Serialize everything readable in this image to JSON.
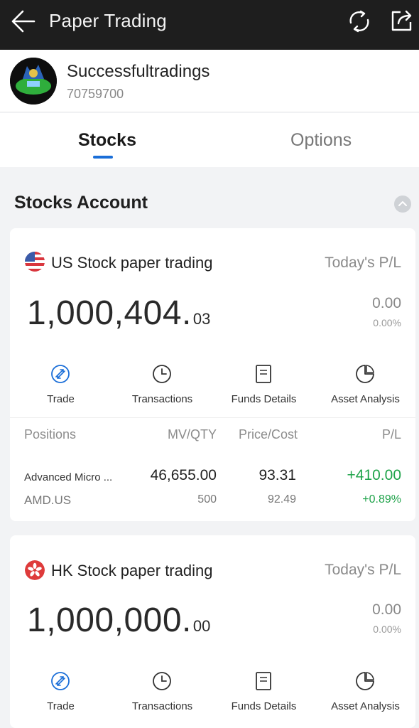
{
  "header": {
    "title": "Paper Trading",
    "back_icon": "arrow-left-icon",
    "refresh_icon": "refresh-icon",
    "share_icon": "share-icon"
  },
  "profile": {
    "name": "Successfultradings",
    "id": "70759700"
  },
  "tabs": [
    {
      "label": "Stocks",
      "active": true
    },
    {
      "label": "Options",
      "active": false
    }
  ],
  "section": {
    "title": "Stocks Account"
  },
  "accounts": [
    {
      "name": "US Stock paper trading",
      "pl_label": "Today's P/L",
      "balance_main": "1,000,404.",
      "balance_cents": "03",
      "pl_value": "0.00",
      "pl_percent": "0.00%",
      "flag_icon": "us-flag-icon"
    },
    {
      "name": "HK Stock paper trading",
      "pl_label": "Today's P/L",
      "balance_main": "1,000,000.",
      "balance_cents": "00",
      "pl_value": "0.00",
      "pl_percent": "0.00%",
      "flag_icon": "hk-flag-icon"
    }
  ],
  "actions": [
    {
      "label": "Trade",
      "icon": "trade-icon"
    },
    {
      "label": "Transactions",
      "icon": "clock-icon"
    },
    {
      "label": "Funds Details",
      "icon": "document-icon"
    },
    {
      "label": "Asset Analysis",
      "icon": "pie-chart-icon"
    }
  ],
  "positions": {
    "headers": [
      "Positions",
      "MV/QTY",
      "Price/Cost",
      "P/L"
    ],
    "rows": [
      {
        "name": "Advanced Micro ...",
        "code": "AMD.US",
        "mv": "46,655.00",
        "qty": "500",
        "price": "93.31",
        "cost": "92.49",
        "pl": "+410.00",
        "pl_percent": "+0.89%"
      }
    ]
  },
  "colors": {
    "accent": "#1a6ed8",
    "gain": "#1fa34a",
    "topbar": "#1e1e1e"
  }
}
